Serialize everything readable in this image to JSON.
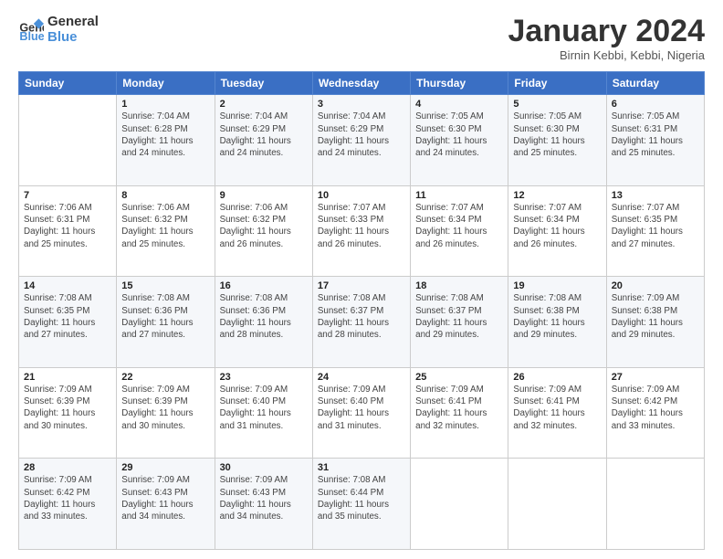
{
  "logo": {
    "line1": "General",
    "line2": "Blue"
  },
  "title": "January 2024",
  "location": "Birnin Kebbi, Kebbi, Nigeria",
  "weekdays": [
    "Sunday",
    "Monday",
    "Tuesday",
    "Wednesday",
    "Thursday",
    "Friday",
    "Saturday"
  ],
  "weeks": [
    [
      {
        "day": "",
        "sunrise": "",
        "sunset": "",
        "daylight": ""
      },
      {
        "day": "1",
        "sunrise": "Sunrise: 7:04 AM",
        "sunset": "Sunset: 6:28 PM",
        "daylight": "Daylight: 11 hours and 24 minutes."
      },
      {
        "day": "2",
        "sunrise": "Sunrise: 7:04 AM",
        "sunset": "Sunset: 6:29 PM",
        "daylight": "Daylight: 11 hours and 24 minutes."
      },
      {
        "day": "3",
        "sunrise": "Sunrise: 7:04 AM",
        "sunset": "Sunset: 6:29 PM",
        "daylight": "Daylight: 11 hours and 24 minutes."
      },
      {
        "day": "4",
        "sunrise": "Sunrise: 7:05 AM",
        "sunset": "Sunset: 6:30 PM",
        "daylight": "Daylight: 11 hours and 24 minutes."
      },
      {
        "day": "5",
        "sunrise": "Sunrise: 7:05 AM",
        "sunset": "Sunset: 6:30 PM",
        "daylight": "Daylight: 11 hours and 25 minutes."
      },
      {
        "day": "6",
        "sunrise": "Sunrise: 7:05 AM",
        "sunset": "Sunset: 6:31 PM",
        "daylight": "Daylight: 11 hours and 25 minutes."
      }
    ],
    [
      {
        "day": "7",
        "sunrise": "Sunrise: 7:06 AM",
        "sunset": "Sunset: 6:31 PM",
        "daylight": "Daylight: 11 hours and 25 minutes."
      },
      {
        "day": "8",
        "sunrise": "Sunrise: 7:06 AM",
        "sunset": "Sunset: 6:32 PM",
        "daylight": "Daylight: 11 hours and 25 minutes."
      },
      {
        "day": "9",
        "sunrise": "Sunrise: 7:06 AM",
        "sunset": "Sunset: 6:32 PM",
        "daylight": "Daylight: 11 hours and 26 minutes."
      },
      {
        "day": "10",
        "sunrise": "Sunrise: 7:07 AM",
        "sunset": "Sunset: 6:33 PM",
        "daylight": "Daylight: 11 hours and 26 minutes."
      },
      {
        "day": "11",
        "sunrise": "Sunrise: 7:07 AM",
        "sunset": "Sunset: 6:34 PM",
        "daylight": "Daylight: 11 hours and 26 minutes."
      },
      {
        "day": "12",
        "sunrise": "Sunrise: 7:07 AM",
        "sunset": "Sunset: 6:34 PM",
        "daylight": "Daylight: 11 hours and 26 minutes."
      },
      {
        "day": "13",
        "sunrise": "Sunrise: 7:07 AM",
        "sunset": "Sunset: 6:35 PM",
        "daylight": "Daylight: 11 hours and 27 minutes."
      }
    ],
    [
      {
        "day": "14",
        "sunrise": "Sunrise: 7:08 AM",
        "sunset": "Sunset: 6:35 PM",
        "daylight": "Daylight: 11 hours and 27 minutes."
      },
      {
        "day": "15",
        "sunrise": "Sunrise: 7:08 AM",
        "sunset": "Sunset: 6:36 PM",
        "daylight": "Daylight: 11 hours and 27 minutes."
      },
      {
        "day": "16",
        "sunrise": "Sunrise: 7:08 AM",
        "sunset": "Sunset: 6:36 PM",
        "daylight": "Daylight: 11 hours and 28 minutes."
      },
      {
        "day": "17",
        "sunrise": "Sunrise: 7:08 AM",
        "sunset": "Sunset: 6:37 PM",
        "daylight": "Daylight: 11 hours and 28 minutes."
      },
      {
        "day": "18",
        "sunrise": "Sunrise: 7:08 AM",
        "sunset": "Sunset: 6:37 PM",
        "daylight": "Daylight: 11 hours and 29 minutes."
      },
      {
        "day": "19",
        "sunrise": "Sunrise: 7:08 AM",
        "sunset": "Sunset: 6:38 PM",
        "daylight": "Daylight: 11 hours and 29 minutes."
      },
      {
        "day": "20",
        "sunrise": "Sunrise: 7:09 AM",
        "sunset": "Sunset: 6:38 PM",
        "daylight": "Daylight: 11 hours and 29 minutes."
      }
    ],
    [
      {
        "day": "21",
        "sunrise": "Sunrise: 7:09 AM",
        "sunset": "Sunset: 6:39 PM",
        "daylight": "Daylight: 11 hours and 30 minutes."
      },
      {
        "day": "22",
        "sunrise": "Sunrise: 7:09 AM",
        "sunset": "Sunset: 6:39 PM",
        "daylight": "Daylight: 11 hours and 30 minutes."
      },
      {
        "day": "23",
        "sunrise": "Sunrise: 7:09 AM",
        "sunset": "Sunset: 6:40 PM",
        "daylight": "Daylight: 11 hours and 31 minutes."
      },
      {
        "day": "24",
        "sunrise": "Sunrise: 7:09 AM",
        "sunset": "Sunset: 6:40 PM",
        "daylight": "Daylight: 11 hours and 31 minutes."
      },
      {
        "day": "25",
        "sunrise": "Sunrise: 7:09 AM",
        "sunset": "Sunset: 6:41 PM",
        "daylight": "Daylight: 11 hours and 32 minutes."
      },
      {
        "day": "26",
        "sunrise": "Sunrise: 7:09 AM",
        "sunset": "Sunset: 6:41 PM",
        "daylight": "Daylight: 11 hours and 32 minutes."
      },
      {
        "day": "27",
        "sunrise": "Sunrise: 7:09 AM",
        "sunset": "Sunset: 6:42 PM",
        "daylight": "Daylight: 11 hours and 33 minutes."
      }
    ],
    [
      {
        "day": "28",
        "sunrise": "Sunrise: 7:09 AM",
        "sunset": "Sunset: 6:42 PM",
        "daylight": "Daylight: 11 hours and 33 minutes."
      },
      {
        "day": "29",
        "sunrise": "Sunrise: 7:09 AM",
        "sunset": "Sunset: 6:43 PM",
        "daylight": "Daylight: 11 hours and 34 minutes."
      },
      {
        "day": "30",
        "sunrise": "Sunrise: 7:09 AM",
        "sunset": "Sunset: 6:43 PM",
        "daylight": "Daylight: 11 hours and 34 minutes."
      },
      {
        "day": "31",
        "sunrise": "Sunrise: 7:08 AM",
        "sunset": "Sunset: 6:44 PM",
        "daylight": "Daylight: 11 hours and 35 minutes."
      },
      {
        "day": "",
        "sunrise": "",
        "sunset": "",
        "daylight": ""
      },
      {
        "day": "",
        "sunrise": "",
        "sunset": "",
        "daylight": ""
      },
      {
        "day": "",
        "sunrise": "",
        "sunset": "",
        "daylight": ""
      }
    ]
  ]
}
